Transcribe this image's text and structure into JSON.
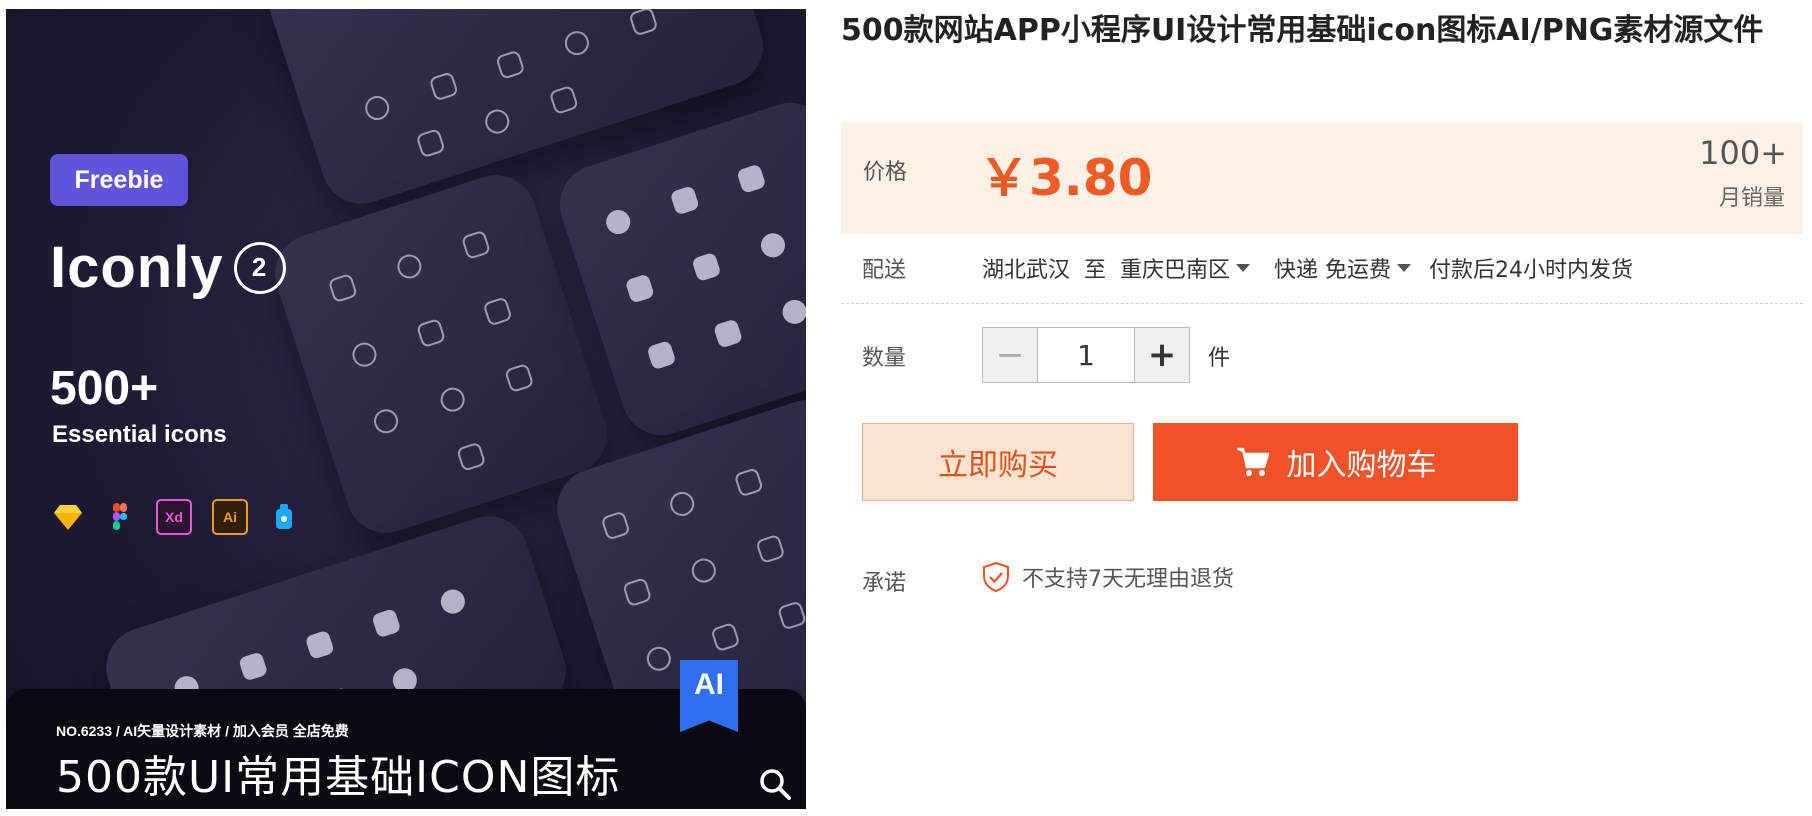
{
  "image": {
    "badge": "Freebie",
    "brand": "Iconly",
    "brand_version": "2",
    "count": "500+",
    "subtitle": "Essential icons",
    "tools": [
      "sketch-icon",
      "figma-icon",
      "Xd",
      "Ai",
      "craft-icon"
    ],
    "ribbon": "AI",
    "banner_meta": "NO.6233 / AI矢量设计素材 / 加入会员 全店免费",
    "banner_title": "500款UI常用基础ICON图标",
    "zoom_icon": "search-icon"
  },
  "product": {
    "title": "500款网站APP小程序UI设计常用基础icon图标AI/PNG素材源文件"
  },
  "price": {
    "label": "价格",
    "value": "￥3.80",
    "sales_count": "100+",
    "sales_label": "月销量"
  },
  "shipping": {
    "label": "配送",
    "from": "湖北武汉",
    "to_word": "至",
    "destination": "重庆巴南区",
    "method": "快递 免运费",
    "dispatch": "付款后24小时内发货"
  },
  "quantity": {
    "label": "数量",
    "value": "1",
    "unit": "件",
    "minus": "−",
    "plus": "+"
  },
  "actions": {
    "buy_now": "立即购买",
    "add_to_cart": "加入购物车"
  },
  "promise": {
    "label": "承诺",
    "text": "不支持7天无理由退货"
  },
  "colors": {
    "accent": "#f0522a",
    "price": "#f15a24",
    "price_bg": "#fdf0e6",
    "badge": "#6254d8",
    "ribbon": "#2f6ff0"
  }
}
